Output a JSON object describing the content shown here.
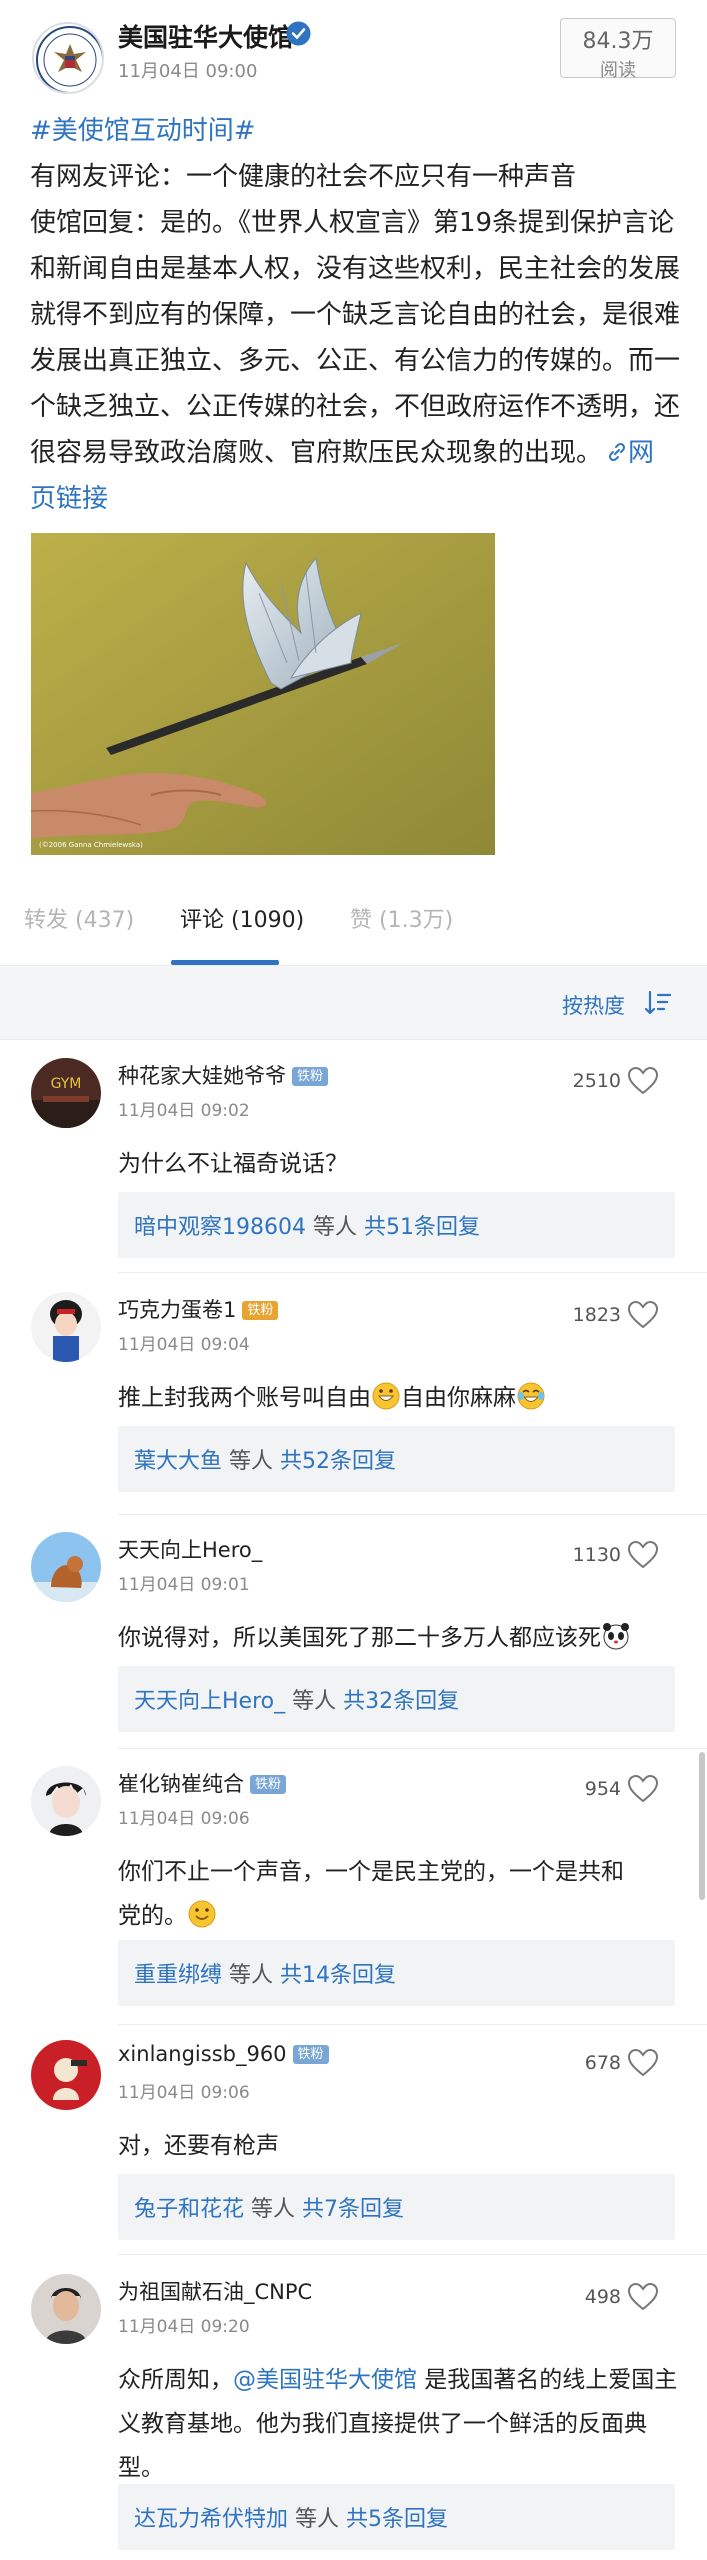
{
  "post": {
    "author": "美国驻华大使馆",
    "time": "11月04日 09:00",
    "reads_count": "84.3万",
    "reads_label": "阅读",
    "hashtag": "#美使馆互动时间#",
    "paragraphs": [
      "有网友评论：一个健康的社会不应只有一种声音",
      "使馆回复：是的。《世界人权宣言》第19条提到保护言论和新闻自由是基本人权，没有这些权利，民主社会的发展就得不到应有的保障，一个缺乏言论自由的社会，是很难发展出真正独立、多元、公正、有公信力的传媒的。而一个缺乏独立、公正传媒的社会，不但政府运作不透明，还很容易导致政治腐败、官府欺压民众现象的出现。"
    ],
    "link_text": "网页链接",
    "image_credit": "(©2006 Ganna Chmielewska)",
    "verified_color": "#f5a623"
  },
  "tabs": [
    {
      "label": "转发 (437)",
      "active": false
    },
    {
      "label": "评论 (1090)",
      "active": true
    },
    {
      "label": "赞 (1.3万)",
      "active": false
    }
  ],
  "sort": {
    "label": "按热度"
  },
  "comments": [
    {
      "name": "种花家大娃她爷爷",
      "badge": "铁粉",
      "time": "11月04日 09:02",
      "likes": "2510",
      "text": "为什么不让福奇说话？",
      "reply_user": "暗中观察198604",
      "reply_etc": " 等人 ",
      "reply_total": "共51条回复"
    },
    {
      "name": "巧克力蛋卷1",
      "badge": "铁粉",
      "time": "11月04日 09:04",
      "likes": "1823",
      "text_a": "推上封我两个账号叫自由",
      "text_b": "自由你麻麻",
      "reply_user": "葉大大鱼",
      "reply_etc": " 等人 ",
      "reply_total": "共52条回复"
    },
    {
      "name": "天天向上Hero_",
      "time": "11月04日 09:01",
      "likes": "1130",
      "text": "你说得对，所以美国死了那二十多万人都应该死",
      "reply_user": "天天向上Hero_",
      "reply_etc": " 等人 ",
      "reply_total": "共32条回复"
    },
    {
      "name": "崔化钠崔纯合",
      "badge": "铁粉",
      "time": "11月04日 09:06",
      "likes": "954",
      "text_line1": "你们不止一个声音，一个是民主党的，一个是共和",
      "text_line2": "党的。",
      "reply_user": "重重绑缚",
      "reply_etc": " 等人 ",
      "reply_total": "共14条回复"
    },
    {
      "name": "xinlangissb_960",
      "badge": "铁粉",
      "time": "11月04日 09:06",
      "likes": "678",
      "text": "对，还要有枪声",
      "reply_user": "兔子和花花",
      "reply_etc": " 等人 ",
      "reply_total": "共7条回复"
    },
    {
      "name": "为祖国献石油_CNPC",
      "time": "11月04日 09:20",
      "likes": "498",
      "text_pre": "众所周知，",
      "mention": "@美国驻华大使馆",
      "text_post": " 是我国著名的线上爱国主义教育基地。他为我们直接提供了一个鲜活的反面典型。",
      "reply_user": "达瓦力希伏特加",
      "reply_etc": " 等人 ",
      "reply_total": "共5条回复"
    }
  ]
}
